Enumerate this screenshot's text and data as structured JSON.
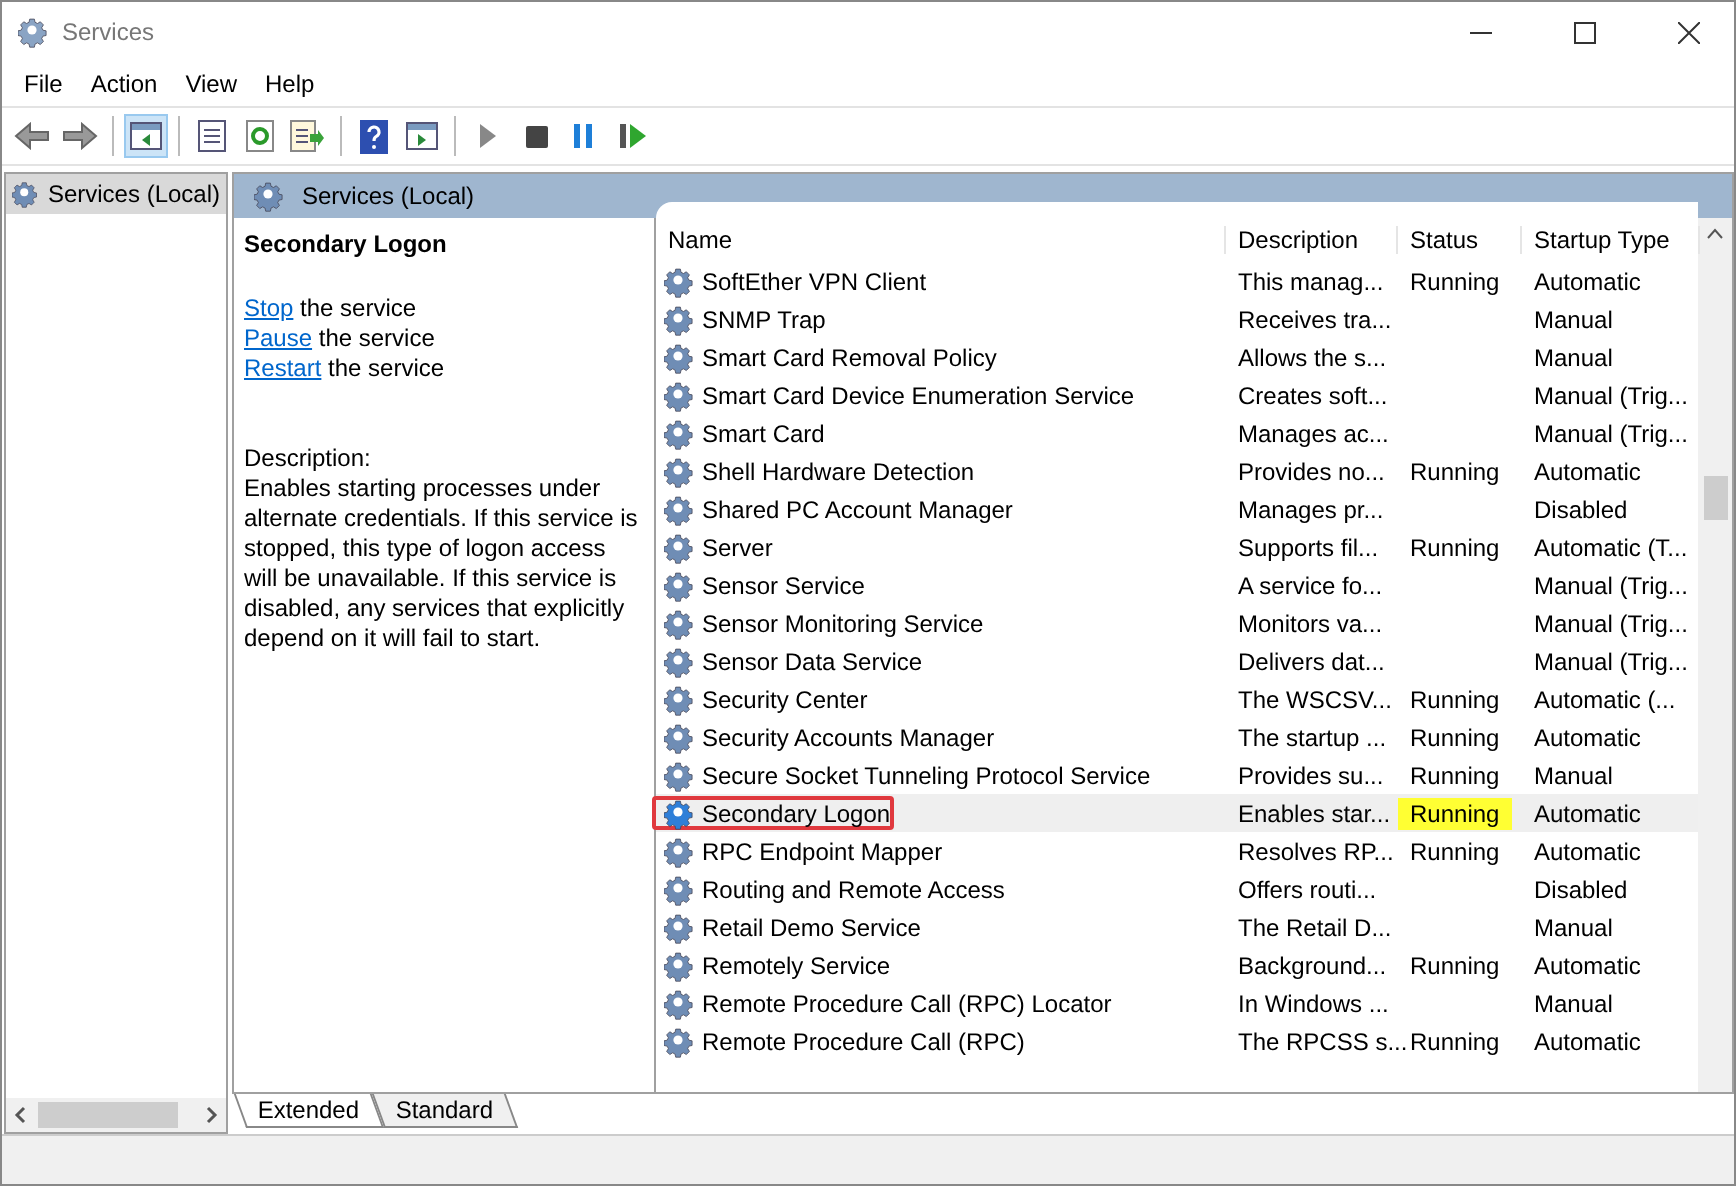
{
  "window": {
    "title": "Services"
  },
  "menu": [
    "File",
    "Action",
    "View",
    "Help"
  ],
  "toolbar": [
    {
      "kind": "back"
    },
    {
      "kind": "forward"
    },
    {
      "kind": "tree",
      "selected": true
    },
    {
      "kind": "properties"
    },
    {
      "kind": "refresh"
    },
    {
      "kind": "export"
    },
    {
      "kind": "help"
    },
    {
      "kind": "view"
    },
    {
      "kind": "start"
    },
    {
      "kind": "stop"
    },
    {
      "kind": "pause"
    },
    {
      "kind": "resume"
    }
  ],
  "tree": [
    {
      "label": "Services (Local)",
      "selected": true
    }
  ],
  "header": {
    "title": "Services (Local)"
  },
  "details": {
    "title": "Secondary Logon",
    "actions": [
      {
        "link": "Stop",
        "rest": " the service"
      },
      {
        "link": "Pause",
        "rest": " the service"
      },
      {
        "link": "Restart",
        "rest": " the service"
      }
    ],
    "description_label": "Description:",
    "description": "Enables starting processes under alternate credentials. If this service is stopped, this type of logon access will be unavailable. If this service is disabled, any services that explicitly depend on it will fail to start."
  },
  "columns": [
    "Name",
    "Description",
    "Status",
    "Startup Type"
  ],
  "rows": [
    {
      "name": "SoftEther VPN Client",
      "description": "This manag...",
      "status": "Running",
      "startup": "Automatic",
      "selected": false
    },
    {
      "name": "SNMP Trap",
      "description": "Receives tra...",
      "status": "",
      "startup": "Manual",
      "selected": false
    },
    {
      "name": "Smart Card Removal Policy",
      "description": "Allows the s...",
      "status": "",
      "startup": "Manual",
      "selected": false
    },
    {
      "name": "Smart Card Device Enumeration Service",
      "description": "Creates soft...",
      "status": "",
      "startup": "Manual (Trig...",
      "selected": false
    },
    {
      "name": "Smart Card",
      "description": "Manages ac...",
      "status": "",
      "startup": "Manual (Trig...",
      "selected": false
    },
    {
      "name": "Shell Hardware Detection",
      "description": "Provides no...",
      "status": "Running",
      "startup": "Automatic",
      "selected": false
    },
    {
      "name": "Shared PC Account Manager",
      "description": "Manages pr...",
      "status": "",
      "startup": "Disabled",
      "selected": false
    },
    {
      "name": "Server",
      "description": "Supports fil...",
      "status": "Running",
      "startup": "Automatic (T...",
      "selected": false
    },
    {
      "name": "Sensor Service",
      "description": "A service fo...",
      "status": "",
      "startup": "Manual (Trig...",
      "selected": false
    },
    {
      "name": "Sensor Monitoring Service",
      "description": "Monitors va...",
      "status": "",
      "startup": "Manual (Trig...",
      "selected": false
    },
    {
      "name": "Sensor Data Service",
      "description": "Delivers dat...",
      "status": "",
      "startup": "Manual (Trig...",
      "selected": false
    },
    {
      "name": "Security Center",
      "description": "The WSCSV...",
      "status": "Running",
      "startup": "Automatic (...",
      "selected": false
    },
    {
      "name": "Security Accounts Manager",
      "description": "The startup ...",
      "status": "Running",
      "startup": "Automatic",
      "selected": false
    },
    {
      "name": "Secure Socket Tunneling Protocol Service",
      "description": "Provides su...",
      "status": "Running",
      "startup": "Manual",
      "selected": false
    },
    {
      "name": "Secondary Logon",
      "description": "Enables star...",
      "status": "Running",
      "startup": "Automatic",
      "selected": true
    },
    {
      "name": "RPC Endpoint Mapper",
      "description": "Resolves RP...",
      "status": "Running",
      "startup": "Automatic",
      "selected": false
    },
    {
      "name": "Routing and Remote Access",
      "description": "Offers routi...",
      "status": "",
      "startup": "Disabled",
      "selected": false
    },
    {
      "name": "Retail Demo Service",
      "description": "The Retail D...",
      "status": "",
      "startup": "Manual",
      "selected": false
    },
    {
      "name": "Remotely Service",
      "description": "Background...",
      "status": "Running",
      "startup": "Automatic",
      "selected": false
    },
    {
      "name": "Remote Procedure Call (RPC) Locator",
      "description": "In Windows ...",
      "status": "",
      "startup": "Manual",
      "selected": false
    },
    {
      "name": "Remote Procedure Call (RPC)",
      "description": "The RPCSS s...",
      "status": "Running",
      "startup": "Automatic",
      "selected": false
    }
  ],
  "tabs": [
    {
      "label": "Extended",
      "selected": true
    },
    {
      "label": "Standard",
      "selected": false
    }
  ]
}
